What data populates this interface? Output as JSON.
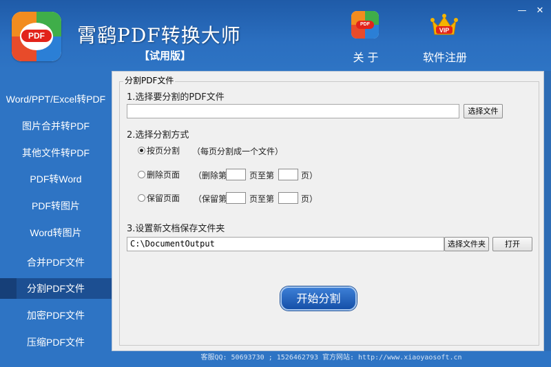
{
  "header": {
    "app_title": "霄鹞PDF转换大师",
    "edition": "【试用版】",
    "logo_text": "PDF",
    "about_label": "关 于",
    "register_label": "软件注册",
    "vip_text": "VIP",
    "minimize_glyph": "—",
    "close_glyph": "✕"
  },
  "sidebar": {
    "items": [
      {
        "label": "Word/PPT/Excel转PDF"
      },
      {
        "label": "图片合并转PDF"
      },
      {
        "label": "其他文件转PDF"
      },
      {
        "label": "PDF转Word"
      },
      {
        "label": "PDF转图片"
      },
      {
        "label": "Word转图片"
      },
      {
        "label": "合并PDF文件"
      },
      {
        "label": "分割PDF文件"
      },
      {
        "label": "加密PDF文件"
      },
      {
        "label": "压缩PDF文件"
      }
    ],
    "active_index": 7
  },
  "main": {
    "group_title": "分割PDF文件",
    "step1_label": "1.选择要分割的PDF文件",
    "file_path": "",
    "choose_file_button": "选择文件",
    "step2_label": "2.选择分割方式",
    "option_by_page": "按页分割",
    "option_by_page_hint": "（每页分割成一个文件）",
    "option_delete": "删除页面",
    "option_delete_from": "（删除第",
    "option_keep": "保留页面",
    "option_keep_from": "（保留第",
    "page_to": "页至第",
    "page_end": "页）",
    "delete_from_value": "",
    "delete_to_value": "",
    "keep_from_value": "",
    "keep_to_value": "",
    "selected_option": "按页分割",
    "step3_label": "3.设置新文档保存文件夹",
    "output_folder": "C:\\DocumentOutput",
    "choose_folder_button": "选择文件夹",
    "open_button": "打开",
    "start_button": "开始分割"
  },
  "footer": {
    "text": "客服QQ: 50693730 ; 1526462793  官方网站: http://www.xiaoyaosoft.cn"
  },
  "colors": {
    "brand_blue": "#2e74c4",
    "active_nav": "#1c4f92",
    "panel_bg": "#f0f0f0"
  }
}
